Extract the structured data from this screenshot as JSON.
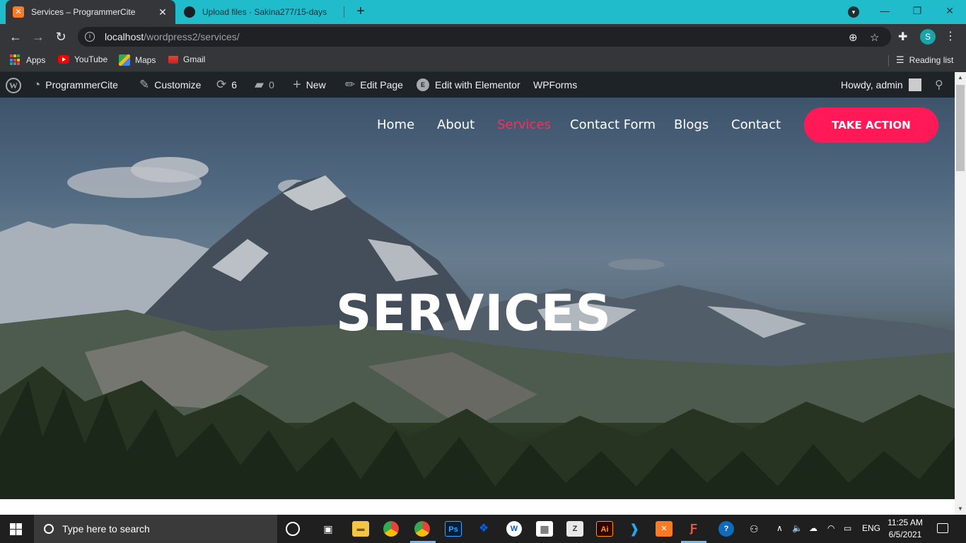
{
  "browser": {
    "tabs": [
      {
        "title": "Services – ProgrammerCite",
        "icon": "xampp-icon",
        "active": true
      },
      {
        "title": "Upload files · Sakina277/15-days",
        "icon": "github-icon",
        "active": false
      }
    ],
    "url_host": "localhost",
    "url_path": "/wordpress2/services/",
    "profile_initial": "S",
    "bookmarks": [
      {
        "label": "Apps",
        "icon": "apps-grid-icon"
      },
      {
        "label": "YouTube",
        "icon": "youtube-icon"
      },
      {
        "label": "Maps",
        "icon": "maps-icon"
      },
      {
        "label": "Gmail",
        "icon": "gmail-icon"
      }
    ],
    "reading_list": "Reading list"
  },
  "adminbar": {
    "site_name": "ProgrammerCite",
    "customize": "Customize",
    "updates_count": "6",
    "comments_count": "0",
    "new_label": "New",
    "edit_page": "Edit Page",
    "edit_elementor": "Edit with Elementor",
    "wpforms": "WPForms",
    "howdy": "Howdy, admin"
  },
  "site": {
    "nav": [
      "Home",
      "About",
      "Services",
      "Contact Form",
      "Blogs",
      "Contact"
    ],
    "current_nav": "Services",
    "cta": "TAKE ACTION",
    "hero_title": "SERVICES",
    "accent_color": "#ff1a57"
  },
  "taskbar": {
    "search_placeholder": "Type here to search",
    "language": "ENG",
    "time": "11:25 AM",
    "date": "6/5/2021"
  }
}
